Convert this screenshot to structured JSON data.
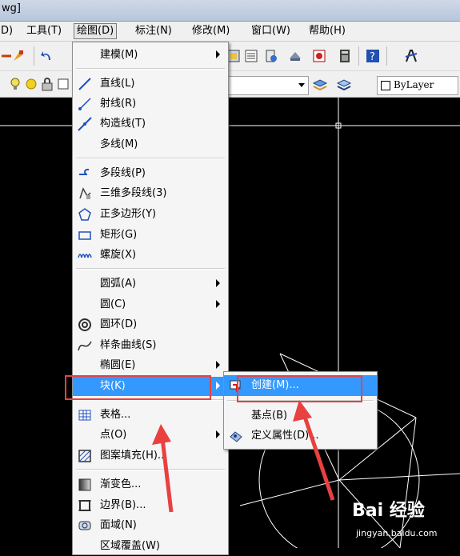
{
  "window": {
    "title_fragment": "wg]"
  },
  "menubar": {
    "items": [
      {
        "label": "D)"
      },
      {
        "label": "工具(T)"
      },
      {
        "label": "绘图(D)"
      },
      {
        "label": "标注(N)"
      },
      {
        "label": "修改(M)"
      },
      {
        "label": "窗口(W)"
      },
      {
        "label": "帮助(H)"
      }
    ]
  },
  "toolbar": {
    "layer_value": "ByLayer"
  },
  "draw_menu": {
    "items": [
      {
        "label": "建模(M)",
        "icon": "none",
        "submenu": true
      },
      {
        "label": "直线(L)",
        "icon": "line-icon"
      },
      {
        "label": "射线(R)",
        "icon": "ray-icon"
      },
      {
        "label": "构造线(T)",
        "icon": "construction-line-icon"
      },
      {
        "label": "多线(M)",
        "icon": "none"
      },
      {
        "label": "多段线(P)",
        "icon": "polyline-icon"
      },
      {
        "label": "三维多段线(3)",
        "icon": "3d-polyline-icon"
      },
      {
        "label": "正多边形(Y)",
        "icon": "polygon-icon"
      },
      {
        "label": "矩形(G)",
        "icon": "rectangle-icon"
      },
      {
        "label": "螺旋(X)",
        "icon": "helix-icon"
      },
      {
        "label": "圆弧(A)",
        "icon": "none",
        "submenu": true
      },
      {
        "label": "圆(C)",
        "icon": "none",
        "submenu": true
      },
      {
        "label": "圆环(D)",
        "icon": "donut-icon"
      },
      {
        "label": "样条曲线(S)",
        "icon": "spline-icon"
      },
      {
        "label": "椭圆(E)",
        "icon": "none",
        "submenu": true
      },
      {
        "label": "块(K)",
        "icon": "none",
        "submenu": true,
        "highlighted": true
      },
      {
        "label": "表格...",
        "icon": "table-icon"
      },
      {
        "label": "点(O)",
        "icon": "none",
        "submenu": true
      },
      {
        "label": "图案填充(H)...",
        "icon": "hatch-icon"
      },
      {
        "label": "渐变色...",
        "icon": "gradient-icon"
      },
      {
        "label": "边界(B)...",
        "icon": "boundary-icon"
      },
      {
        "label": "面域(N)",
        "icon": "region-icon"
      },
      {
        "label": "区域覆盖(W)",
        "icon": "none"
      }
    ]
  },
  "block_submenu": {
    "items": [
      {
        "label": "创建(M)...",
        "icon": "create-block-icon",
        "highlighted": true
      },
      {
        "label": "基点(B)",
        "icon": "none"
      },
      {
        "label": "定义属性(D)...",
        "icon": "define-attribute-icon"
      }
    ]
  },
  "watermark": {
    "brand": "Bai 经验",
    "url": "jingyan.baidu.com"
  },
  "colors": {
    "highlight": "#3399ff",
    "annotation_red": "#e8413f",
    "canvas": "#000000"
  }
}
